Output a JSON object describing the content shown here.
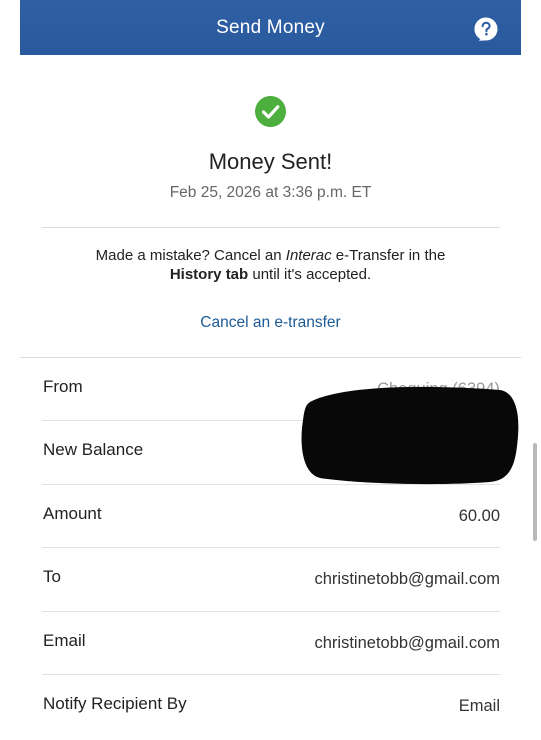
{
  "header": {
    "title": "Send Money",
    "help_icon": "question-bubble-icon"
  },
  "status": {
    "icon": "check-circle-icon",
    "icon_color": "#4caf3e",
    "title": "Money Sent!",
    "timestamp": "Feb 25, 2026 at 3:36 p.m. ET"
  },
  "notice": {
    "part1": "Made a mistake? Cancel an ",
    "interac": "Interac",
    "part2": " e-Transfer in the",
    "history_tab": "History tab",
    "part3": " until it's accepted."
  },
  "cancel_link": "Cancel an e-transfer",
  "details": [
    {
      "label": "From",
      "value": "Chequing (6394)"
    },
    {
      "label": "New Balance",
      "value": ""
    },
    {
      "label": "Amount",
      "value": "60.00"
    },
    {
      "label": "To",
      "value": "christinetobb@gmail.com"
    },
    {
      "label": "Email",
      "value": "christinetobb@gmail.com"
    },
    {
      "label": "Notify Recipient By",
      "value": "Email"
    }
  ],
  "colors": {
    "header": "#2f5fa4",
    "link": "#1d5b96",
    "success": "#4caf3e"
  }
}
